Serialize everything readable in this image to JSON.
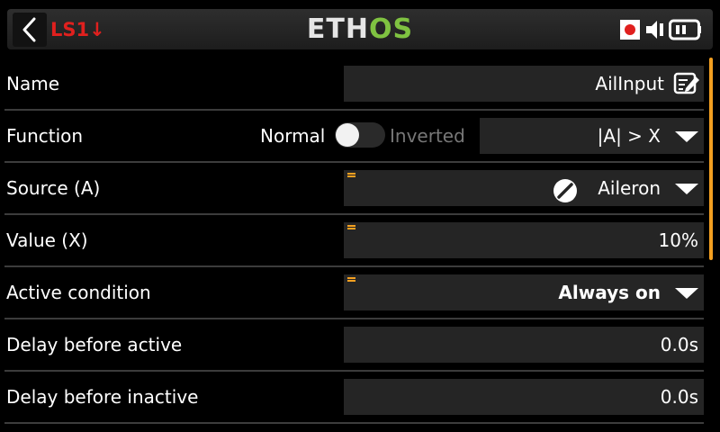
{
  "header": {
    "screen_id": "LS1↓",
    "logo_part1": "ETH",
    "logo_part2": "OS",
    "icons": [
      "back-icon",
      "record-icon",
      "speaker-icon",
      "battery-icon"
    ],
    "colors": {
      "screen_id": "#e0201e",
      "logo_accent": "#7fc241",
      "record": "#e0201e",
      "accent": "#f4a020"
    }
  },
  "rows": {
    "name": {
      "label": "Name",
      "value": "AilInput"
    },
    "function": {
      "label": "Function",
      "normal": "Normal",
      "inverted": "Inverted",
      "toggle_state": "normal",
      "value": "|A| > X"
    },
    "source": {
      "label": "Source (A)",
      "value": "Aileron"
    },
    "value_x": {
      "label": "Value (X)",
      "value": "10%"
    },
    "active_condition": {
      "label": "Active condition",
      "value": "Always on"
    },
    "delay_active": {
      "label": "Delay before active",
      "value": "0.0s"
    },
    "delay_inactive": {
      "label": "Delay before inactive",
      "value": "0.0s"
    }
  }
}
